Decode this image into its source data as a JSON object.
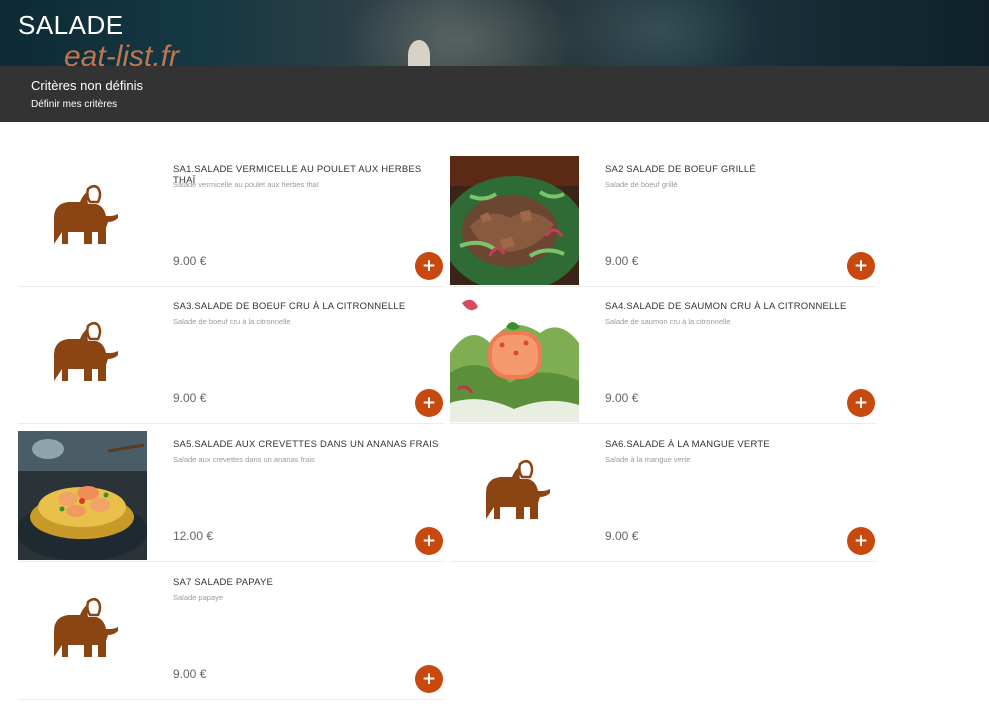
{
  "header": {
    "title": "SALADE",
    "watermark": "eat-list.fr"
  },
  "filter_bar": {
    "title": "Critères non définis",
    "link": "Définir mes critères"
  },
  "colors": {
    "accent": "#c8490d",
    "placeholder_icon": "#8b4513",
    "bar": "#333333"
  },
  "add_icon": "+",
  "items": [
    {
      "name": "SA1.SALADE VERMICELLE AU POULET AUX HERBES THAÏ",
      "description": "Salade vermicelle au poulet aux herbes thaï",
      "price": "9.00 €",
      "image": "elephant-placeholder-icon"
    },
    {
      "name": "SA2 SALADE DE BOEUF GRILLÉ",
      "description": "Salade de boeuf grillé",
      "price": "9.00 €",
      "image": "beef-salad-photo"
    },
    {
      "name": "SA3.SALADE DE BOEUF CRU À LA CITRONNELLE",
      "description": "Salade de boeuf cru à la citronnelle",
      "price": "9.00 €",
      "image": "elephant-placeholder-icon"
    },
    {
      "name": "SA4.SALADE DE SAUMON CRU À LA CITRONNELLE",
      "description": "Salade de saumon cru à la citronnelle",
      "price": "9.00 €",
      "image": "salmon-tartare-photo"
    },
    {
      "name": "SA5.SALADE AUX CREVETTES DANS UN ANANAS FRAIS",
      "description": "Salade aux crevettes dans un ananas frais",
      "price": "12.00 €",
      "image": "shrimp-pineapple-photo"
    },
    {
      "name": "SA6.SALADE À LA MANGUE VERTE",
      "description": "Salade à la mangue verte",
      "price": "9.00 €",
      "image": "elephant-placeholder-icon"
    },
    {
      "name": "SA7 SALADE PAPAYE",
      "description": "Salade papaye",
      "price": "9.00 €",
      "image": "elephant-placeholder-icon"
    }
  ]
}
